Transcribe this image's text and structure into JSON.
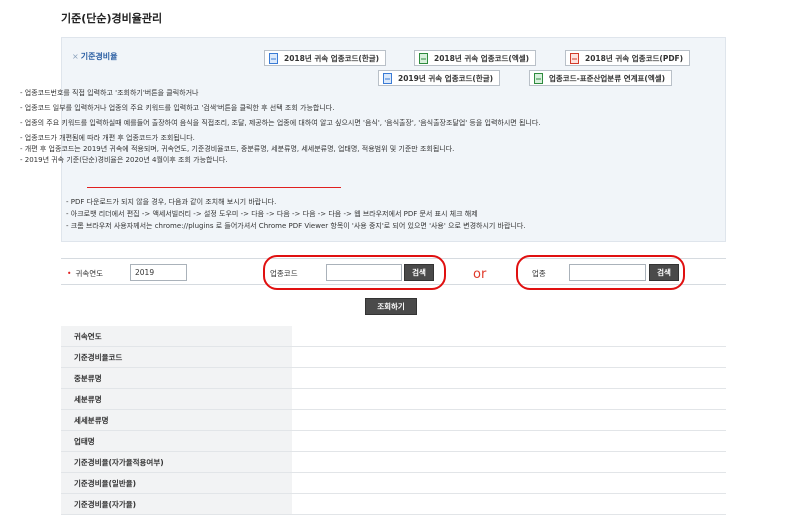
{
  "page_title": "기준(단순)경비율관리",
  "info": {
    "heading_icon": "×",
    "heading": "기준경비율",
    "downloads": [
      {
        "label": "2018년 귀속 업종코드(한글)",
        "icon": "hwp"
      },
      {
        "label": "2018년 귀속 업종코드(엑셀)",
        "icon": "xls"
      },
      {
        "label": "2018년 귀속 업종코드(PDF)",
        "icon": "pdf"
      },
      {
        "label": "2019년 귀속 업종코드(한글)",
        "icon": "hwp"
      },
      {
        "label": "업종코드-표준산업분류 연계표(엑셀)",
        "icon": "xls"
      }
    ],
    "notes": [
      "- 업종코드번호를 직접 입력하고 '조회하기'버튼을 클릭하거나",
      "- 업종코드 일부를 입력하거나 업종의 주요 키워드를 입력하고 '검색'버튼을 클릭한 후 선택 조회 가능합니다.",
      "- 업종의 주요 키워드를 입력하실때 예를들어 출장하여 음식을 직접조리, 조달, 제공하는 업종에 대하여 알고 싶으시면 '음식', '음식출장', '음식출장조달업' 등을 입력하시면 됩니다.",
      "- 업종코드가 개편됨에 따라 개편 후 업종코드가 조회됩니다.",
      "- 개편 후 업종코드는 2019년 귀속에 적용되며, 귀속연도, 기준경비율코드, 중분류명, 세분류명, 세세분류명, 업태명, 적용범위 및 기준만 조회됩니다.",
      "- 2019년 귀속 기준(단순)경비율은 2020년 4월이후 조회 가능합니다."
    ],
    "pdf_notes": [
      "- PDF 다운로드가 되지 않을 경우, 다음과 같이 조치해 보시기 바랍니다.",
      "- 아크로뱃 리더에서 편집 -> 액세서빌러티 -> 설정 도우미 -> 다음 -> 다음 -> 다음 -> 다음 -> 웹 브라우저에서 PDF 문서 표시 체크 해제",
      "- 크롬 브라우저 사용자께서는 chrome://plugins 로 들어가셔서 Chrome PDF Viewer 항목이 '사용 중지'로 되어 있으면 '사용' 으로 변경하시기 바랍니다."
    ]
  },
  "search": {
    "year_label": "귀속연도",
    "year_value": "2019",
    "code_label": "업종코드",
    "code_value": "",
    "search_button": "검색",
    "or_text": "or",
    "industry_label": "업종",
    "industry_value": "",
    "query_button": "조회하기"
  },
  "results": [
    "귀속연도",
    "기준경비율코드",
    "중분류명",
    "세분류명",
    "세세분류명",
    "업태명",
    "기준경비율(자가율적용여부)",
    "기준경비율(일반율)",
    "기준경비율(자가율)"
  ],
  "colors": {
    "annotation_red": "#e01010",
    "link_blue": "#2b5fa3",
    "button_dark": "#4a4a4a"
  }
}
